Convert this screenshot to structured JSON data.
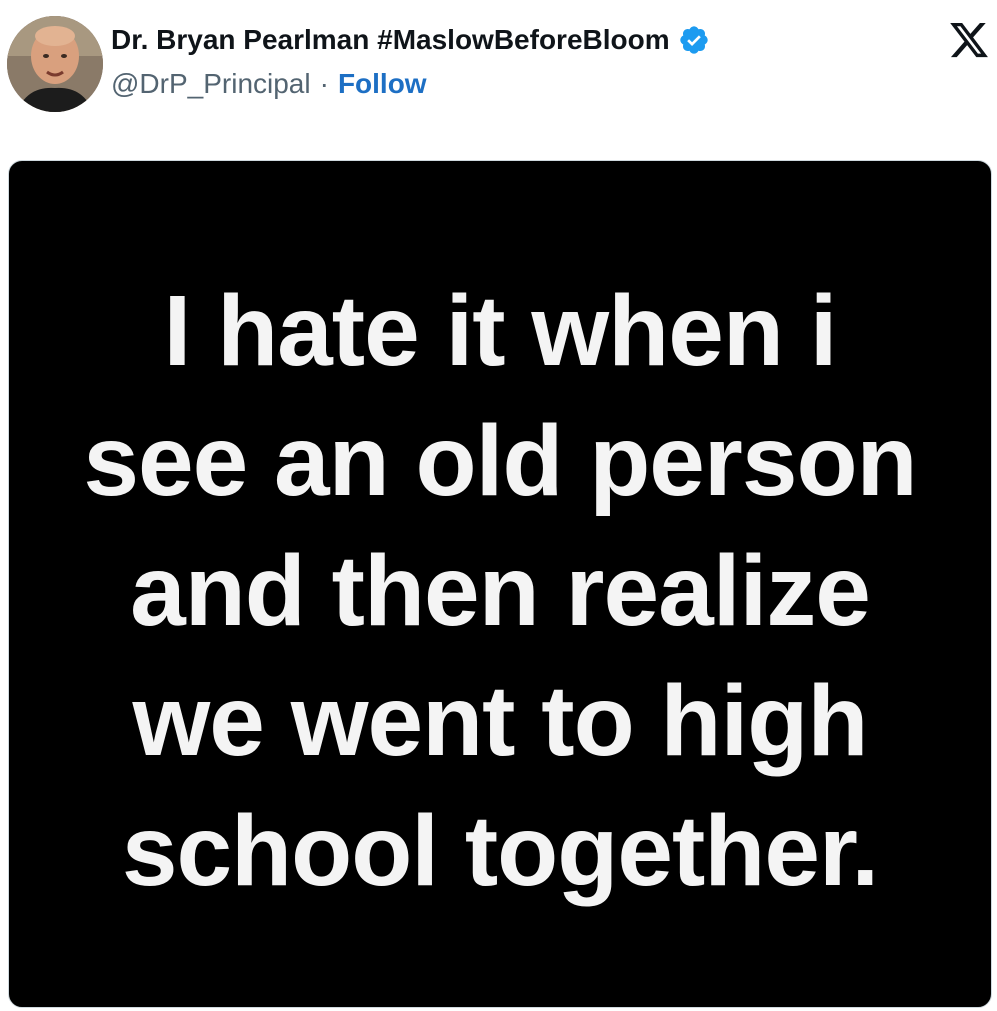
{
  "author": {
    "display_name": "Dr. Bryan Pearlman #MaslowBeforeBloom",
    "handle": "@DrP_Principal",
    "separator": "·",
    "follow_label": "Follow",
    "verified": true,
    "verified_color": "#1d9bf0",
    "avatar": "profile-photo"
  },
  "platform": {
    "logo": "x-logo-icon"
  },
  "media": {
    "background_color": "#000000",
    "text_color": "#f4f4f4",
    "lines": [
      "I hate it when i",
      "see an old person",
      "and then realize",
      "we went to high",
      "school together."
    ]
  },
  "colors": {
    "name": "#0f1419",
    "handle": "#536471",
    "follow": "#1d6fc4"
  }
}
